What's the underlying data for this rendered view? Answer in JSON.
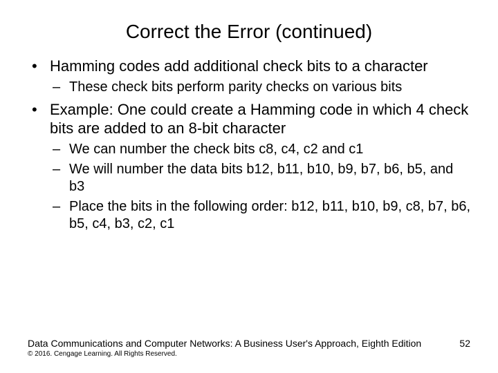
{
  "title": "Correct the Error (continued)",
  "bullets": {
    "b1": "Hamming codes add additional check bits to a character",
    "b1s1": "These check bits perform parity checks on various bits",
    "b2": "Example: One could create a Hamming code in which 4 check bits are added to an 8-bit character",
    "b2s1": "We can number the check bits c8, c4, c2 and c1",
    "b2s2": "We will number the data bits b12, b11, b10, b9, b7, b6, b5, and b3",
    "b2s3": "Place the bits in the following order: b12, b11, b10, b9, c8, b7, b6, b5, c4, b3, c2, c1"
  },
  "footer": {
    "source": "Data Communications and Computer Networks: A Business User's Approach, Eighth Edition",
    "page": "52",
    "copyright": "© 2016. Cengage Learning. All Rights Reserved."
  }
}
